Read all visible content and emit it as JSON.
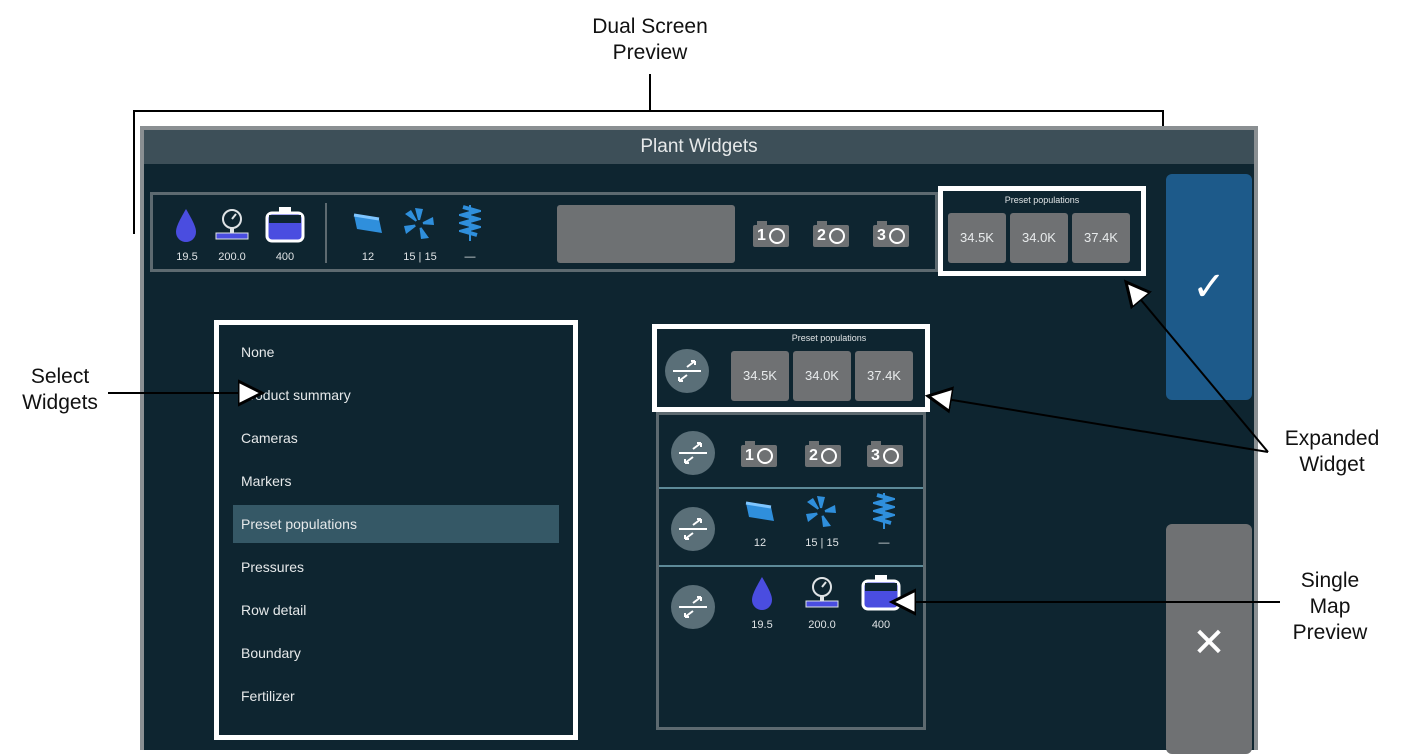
{
  "callouts": {
    "dual_screen_line1": "Dual Screen",
    "dual_screen_line2": "Preview",
    "select_line1": "Select",
    "select_line2": "Widgets",
    "expanded_line1": "Expanded",
    "expanded_line2": "Widget",
    "single_line1": "Single",
    "single_line2": "Map",
    "single_line3": "Preview"
  },
  "screen": {
    "title": "Plant Widgets"
  },
  "widget_bar": {
    "moisture_value": "19.5",
    "pressure_value": "200.0",
    "tank_value": "400",
    "seed_value": "12",
    "fan_value": "15 | 15",
    "auger_value": "—",
    "camera1": "1",
    "camera2": "2",
    "camera3": "3"
  },
  "preset_top": {
    "label": "Preset populations",
    "buttons": [
      "34.5K",
      "34.0K",
      "37.4K"
    ]
  },
  "menu": {
    "items": [
      "None",
      "Product summary",
      "Cameras",
      "Markers",
      "Preset populations",
      "Pressures",
      "Row detail",
      "Boundary",
      "Fertilizer"
    ],
    "selected_index": 4
  },
  "single_preview": {
    "preset_label": "Preset populations",
    "preset_buttons": [
      "34.5K",
      "34.0K",
      "37.4K"
    ],
    "cameras": [
      "1",
      "2",
      "3"
    ],
    "seed_value": "12",
    "fan_value": "15 | 15",
    "auger_value": "—",
    "moisture_value": "19.5",
    "pressure_value": "200.0",
    "tank_value": "400"
  },
  "actions": {
    "confirm": "✓",
    "cancel": "✕"
  },
  "colors": {
    "background": "#0e2530",
    "titlebar": "#3d4f58",
    "accent_blue": "#1d5a8a",
    "icon_blue": "#4a4de0",
    "selected_row": "#355866",
    "button_gray": "#6f7173"
  }
}
